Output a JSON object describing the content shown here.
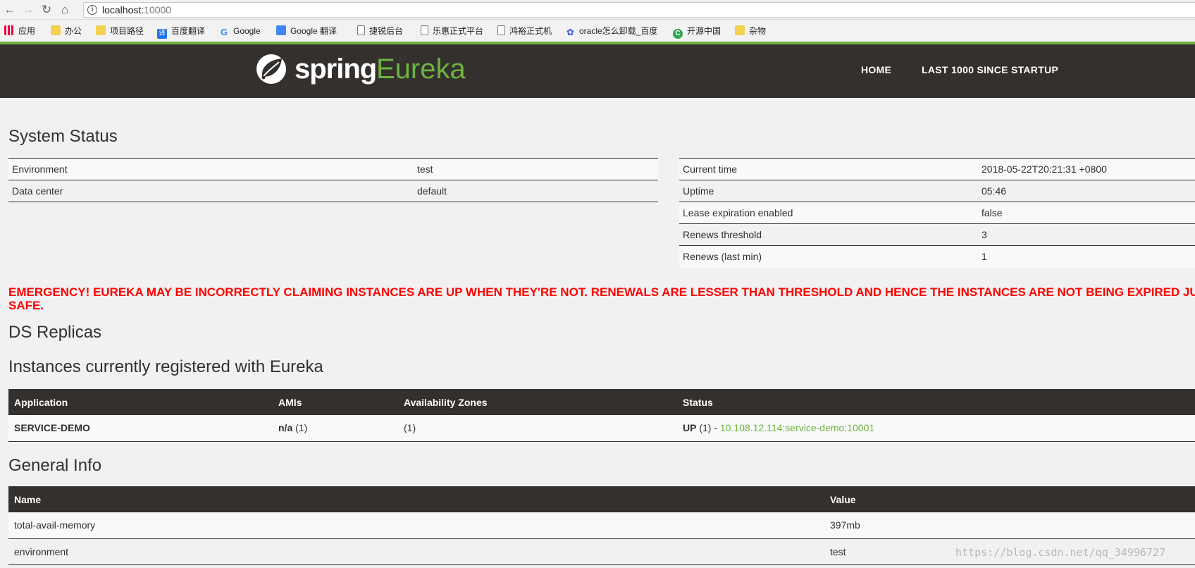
{
  "browser": {
    "url_host": "localhost:",
    "url_port": "10000",
    "bookmarks": [
      {
        "label": "应用",
        "icon": "apps-icon"
      },
      {
        "label": "办公",
        "icon": "folder-icon"
      },
      {
        "label": "项目路径",
        "icon": "folder-icon"
      },
      {
        "label": "百度翻译",
        "icon": "baidu-translate-icon"
      },
      {
        "label": "Google",
        "icon": "google-icon"
      },
      {
        "label": "Google 翻译",
        "icon": "google-translate-icon"
      },
      {
        "label": "捷锐后台",
        "icon": "page-icon"
      },
      {
        "label": "乐惠正式平台",
        "icon": "page-icon"
      },
      {
        "label": "鸿裕正式机",
        "icon": "page-icon"
      },
      {
        "label": "oracle怎么卸载_百度",
        "icon": "baidu-paw-icon"
      },
      {
        "label": "开源中国",
        "icon": "oschina-icon"
      },
      {
        "label": "杂物",
        "icon": "folder-icon"
      }
    ]
  },
  "navbar": {
    "logo_spring": "spring",
    "logo_eureka": "Eureka",
    "home": "HOME",
    "last1000": "LAST 1000 SINCE STARTUP"
  },
  "system_status": {
    "title": "System Status",
    "left": [
      {
        "k": "Environment",
        "v": "test"
      },
      {
        "k": "Data center",
        "v": "default"
      }
    ],
    "right": [
      {
        "k": "Current time",
        "v": "2018-05-22T20:21:31 +0800"
      },
      {
        "k": "Uptime",
        "v": "05:46"
      },
      {
        "k": "Lease expiration enabled",
        "v": "false"
      },
      {
        "k": "Renews threshold",
        "v": "3"
      },
      {
        "k": "Renews (last min)",
        "v": "1"
      }
    ]
  },
  "emergency": "EMERGENCY! EUREKA MAY BE INCORRECTLY CLAIMING INSTANCES ARE UP WHEN THEY'RE NOT. RENEWALS ARE LESSER THAN THRESHOLD AND HENCE THE INSTANCES ARE NOT BEING EXPIRED JUST TO BE",
  "emergency_line2": "SAFE.",
  "ds_replicas": "DS Replicas",
  "instances": {
    "title": "Instances currently registered with Eureka",
    "headers": [
      "Application",
      "AMIs",
      "Availability Zones",
      "Status"
    ],
    "row": {
      "application": "SERVICE-DEMO",
      "ami": "n/a",
      "ami_count": "(1)",
      "zones": "(1)",
      "status": "UP",
      "status_count": "(1) -",
      "instance_link": "10.108.12.114:service-demo:10001"
    }
  },
  "general_info": {
    "title": "General Info",
    "headers": [
      "Name",
      "Value"
    ],
    "rows": [
      {
        "name": "total-avail-memory",
        "value": "397mb"
      },
      {
        "name": "environment",
        "value": "test"
      }
    ]
  },
  "watermark": "https://blog.csdn.net/qq_34996727"
}
